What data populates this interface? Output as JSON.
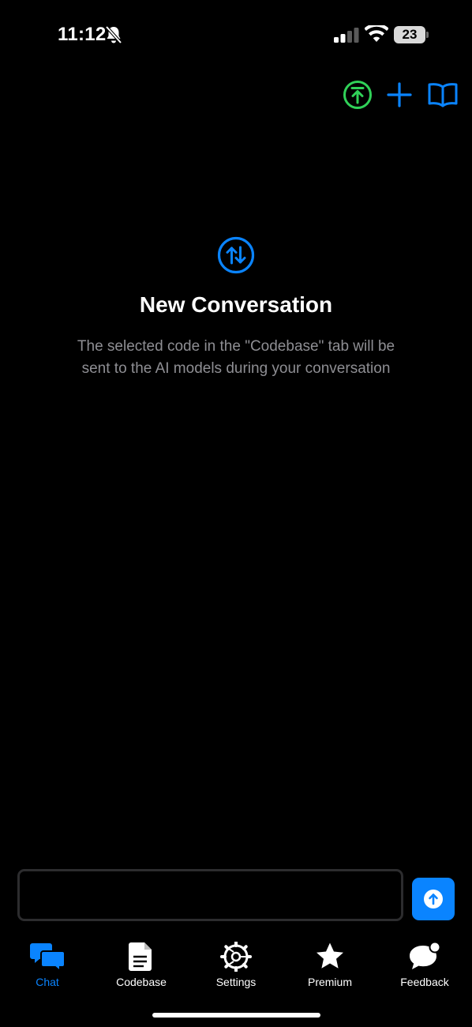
{
  "status_bar": {
    "time": "11:12",
    "battery_level": "23",
    "icons": [
      "bell-slash-icon",
      "cellular-signal-icon",
      "wifi-icon",
      "battery-icon"
    ]
  },
  "header": {
    "actions": [
      {
        "name": "export-icon",
        "color": "#30d158"
      },
      {
        "name": "plus-icon",
        "color": "#0a84ff"
      },
      {
        "name": "book-icon",
        "color": "#0a84ff"
      }
    ]
  },
  "empty_state": {
    "icon": "arrows-up-down-circle-icon",
    "title": "New Conversation",
    "description": "The selected code in the \"Codebase\" tab will be sent to the AI models during your conversation"
  },
  "composer": {
    "value": "",
    "placeholder": "",
    "send_icon": "arrow-up-circle-icon"
  },
  "tab_bar": {
    "tabs": [
      {
        "label": "Chat",
        "icon": "chat-bubbles-icon",
        "active": true
      },
      {
        "label": "Codebase",
        "icon": "document-icon",
        "active": false
      },
      {
        "label": "Settings",
        "icon": "gear-icon",
        "active": false
      },
      {
        "label": "Premium",
        "icon": "star-icon",
        "active": false
      },
      {
        "label": "Feedback",
        "icon": "feedback-bubble-icon",
        "active": false
      }
    ]
  },
  "colors": {
    "accent": "#0a84ff",
    "success": "#30d158",
    "background": "#000000",
    "secondary_text": "#8e8e93"
  }
}
